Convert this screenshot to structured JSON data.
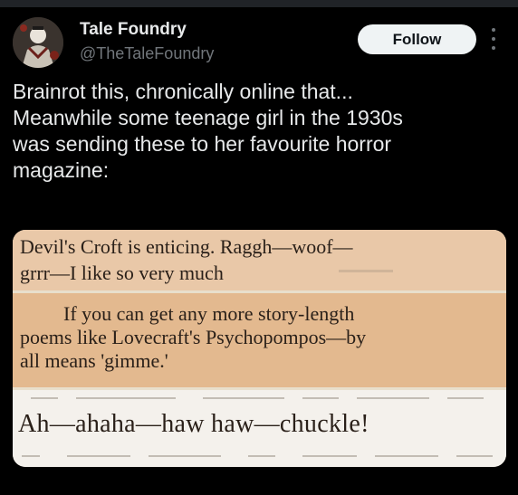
{
  "author": {
    "name": "Tale Foundry",
    "handle": "@TheTaleFoundry"
  },
  "actions": {
    "follow_label": "Follow"
  },
  "tweet": {
    "text": "Brainrot this, chronically online that...\nMeanwhile some teenage girl in  the 1930s\nwas sending these to her favourite horror\nmagazine:"
  },
  "media": {
    "clip1": {
      "line1": "Devil's Croft is enticing.  Raggh—woof—",
      "line2": "grrr—I  like  so  very  much"
    },
    "clip2": {
      "line1": "If  you  can  get  any  more  story-length",
      "line2": "poems  like  Lovecraft's  Psychopompos—by",
      "line3": "all  means  'gimme.'"
    },
    "clip3": {
      "line1": "Ah—ahaha—haw  haw—chuckle!"
    }
  },
  "icons": {
    "avatar": "avatar-image",
    "more": "more-icon"
  }
}
